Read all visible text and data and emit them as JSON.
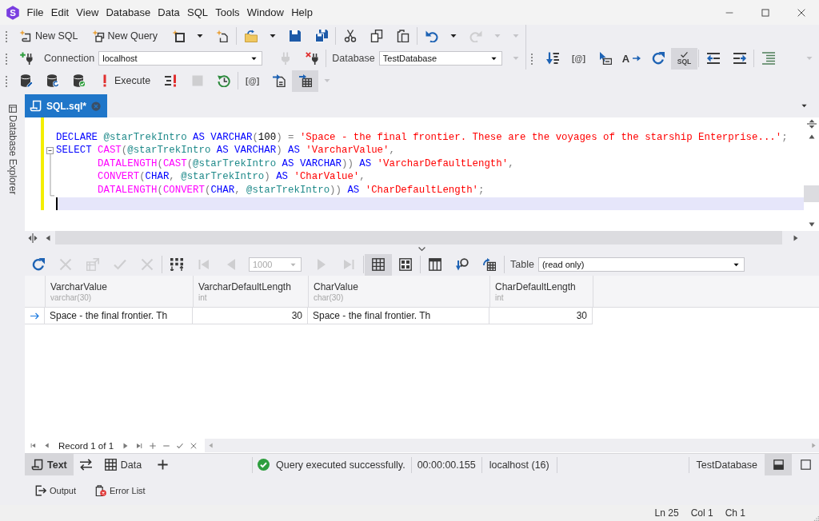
{
  "logo": {
    "letter": "S"
  },
  "menu": [
    "File",
    "Edit",
    "View",
    "Database",
    "Data",
    "SQL",
    "Tools",
    "Window",
    "Help"
  ],
  "toolbars": [
    {
      "groups": [
        [
          {
            "kind": "button",
            "label": "New SQL",
            "disabled": false
          },
          {
            "kind": "button",
            "label": "New Query",
            "disabled": false
          },
          {
            "kind": "button",
            "disabled": false
          },
          {
            "kind": "caret",
            "disabled": false
          },
          {
            "kind": "button",
            "disabled": false
          }
        ],
        [
          {
            "kind": "button",
            "disabled": false
          },
          {
            "kind": "caret",
            "disabled": false
          },
          {
            "kind": "button",
            "disabled": false
          },
          {
            "kind": "button",
            "disabled": false
          }
        ],
        [
          {
            "kind": "button",
            "disabled": false
          },
          {
            "kind": "button",
            "disabled": false
          },
          {
            "kind": "button",
            "disabled": false
          }
        ],
        [
          {
            "kind": "button",
            "disabled": false
          },
          {
            "kind": "caret",
            "disabled": false
          },
          {
            "kind": "button",
            "disabled": true
          },
          {
            "kind": "caret",
            "disabled": true
          },
          {
            "kind": "overflow",
            "disabled": true
          }
        ]
      ]
    },
    {
      "groups": [
        [
          {
            "kind": "button",
            "disabled": false
          },
          {
            "kind": "label",
            "text": "Connection",
            "disabled": false
          },
          {
            "kind": "combo",
            "value": "localhost",
            "disabled": false
          },
          {
            "kind": "button",
            "disabled": true
          },
          {
            "kind": "button",
            "disabled": false
          }
        ],
        [
          {
            "kind": "label",
            "text": "Database",
            "disabled": false
          },
          {
            "kind": "combo",
            "value": "TestDatabase",
            "disabled": false
          },
          {
            "kind": "overflow",
            "disabled": true
          }
        ]
      ]
    },
    {
      "groups": [
        [
          {
            "kind": "button",
            "disabled": false
          },
          {
            "kind": "button",
            "icon_text": "[@]",
            "disabled": false
          },
          {
            "kind": "button",
            "disabled": false
          },
          {
            "kind": "button",
            "icon_text": "A",
            "disabled": false
          },
          {
            "kind": "button",
            "disabled": false
          },
          {
            "kind": "toggle",
            "icon_text": "SQL",
            "disabled": false,
            "on": true
          }
        ],
        [
          {
            "kind": "button",
            "disabled": false
          },
          {
            "kind": "button",
            "disabled": false
          }
        ],
        [
          {
            "kind": "button",
            "disabled": false
          },
          {
            "kind": "overflow",
            "disabled": true
          }
        ]
      ]
    },
    {
      "groups": [
        [
          {
            "kind": "button",
            "disabled": false
          },
          {
            "kind": "button",
            "disabled": false
          },
          {
            "kind": "button",
            "disabled": false
          },
          {
            "kind": "button",
            "label": "Execute",
            "disabled": false
          },
          {
            "kind": "button",
            "disabled": false
          },
          {
            "kind": "button",
            "disabled": true
          },
          {
            "kind": "button",
            "disabled": false
          }
        ],
        [
          {
            "kind": "button",
            "icon_text": "[@]",
            "disabled": false
          },
          {
            "kind": "button",
            "disabled": false
          },
          {
            "kind": "toggle",
            "disabled": false,
            "on": true
          },
          {
            "kind": "caret",
            "disabled": true
          }
        ]
      ]
    }
  ],
  "document_tabs": [
    {
      "title": "SQL.sql*",
      "selected": true
    }
  ],
  "side_panel": {
    "label": "Database Explorer"
  },
  "editor": {
    "lines": [
      {
        "modified": true,
        "tokens": [
          {
            "kind": "keyword",
            "text": "DECLARE "
          },
          {
            "kind": "variable",
            "text": "@starTrekIntro "
          },
          {
            "kind": "keyword",
            "text": "AS VARCHAR"
          },
          {
            "kind": "punct",
            "text": "("
          },
          {
            "kind": "number",
            "text": "100"
          },
          {
            "kind": "punct",
            "text": ") = "
          },
          {
            "kind": "string",
            "text": "'Space - the final frontier. These are the voyages of the starship Enterprise...'"
          },
          {
            "kind": "punct",
            "text": ";"
          }
        ]
      },
      {
        "modified": true,
        "expanded": true,
        "tokens": [
          {
            "kind": "keyword",
            "text": "SELECT "
          },
          {
            "kind": "function",
            "text": "CAST"
          },
          {
            "kind": "punct",
            "text": "("
          },
          {
            "kind": "variable",
            "text": "@starTrekIntro "
          },
          {
            "kind": "keyword",
            "text": "AS VARCHAR"
          },
          {
            "kind": "punct",
            "text": ") "
          },
          {
            "kind": "keyword",
            "text": "AS "
          },
          {
            "kind": "string",
            "text": "'VarcharValue'"
          },
          {
            "kind": "punct",
            "text": ","
          }
        ],
        "children": [
          {
            "modified": true,
            "tokens": [
              {
                "kind": "function",
                "text": "DATALENGTH"
              },
              {
                "kind": "punct",
                "text": "("
              },
              {
                "kind": "function",
                "text": "CAST"
              },
              {
                "kind": "punct",
                "text": "("
              },
              {
                "kind": "variable",
                "text": "@starTrekIntro "
              },
              {
                "kind": "keyword",
                "text": "AS VARCHAR"
              },
              {
                "kind": "punct",
                "text": ")) "
              },
              {
                "kind": "keyword",
                "text": "AS "
              },
              {
                "kind": "string",
                "text": "'VarcharDefaultLength'"
              },
              {
                "kind": "punct",
                "text": ","
              }
            ]
          },
          {
            "modified": true,
            "tokens": [
              {
                "kind": "function",
                "text": "CONVERT"
              },
              {
                "kind": "punct",
                "text": "("
              },
              {
                "kind": "keyword",
                "text": "CHAR"
              },
              {
                "kind": "punct",
                "text": ", "
              },
              {
                "kind": "variable",
                "text": "@starTrekIntro"
              },
              {
                "kind": "punct",
                "text": ") "
              },
              {
                "kind": "keyword",
                "text": "AS "
              },
              {
                "kind": "string",
                "text": "'CharValue'"
              },
              {
                "kind": "punct",
                "text": ","
              }
            ]
          },
          {
            "modified": true,
            "tokens": [
              {
                "kind": "function",
                "text": "DATALENGTH"
              },
              {
                "kind": "punct",
                "text": "("
              },
              {
                "kind": "function",
                "text": "CONVERT"
              },
              {
                "kind": "punct",
                "text": "("
              },
              {
                "kind": "keyword",
                "text": "CHAR"
              },
              {
                "kind": "punct",
                "text": ", "
              },
              {
                "kind": "variable",
                "text": "@starTrekIntro"
              },
              {
                "kind": "punct",
                "text": ")) "
              },
              {
                "kind": "keyword",
                "text": "AS "
              },
              {
                "kind": "string",
                "text": "'CharDefaultLength'"
              },
              {
                "kind": "punct",
                "text": ";"
              }
            ]
          }
        ]
      }
    ]
  },
  "results": {
    "toolbar": {
      "groups": [
        [
          {
            "kind": "button",
            "disabled": false
          },
          {
            "kind": "button",
            "disabled": true
          },
          {
            "kind": "button",
            "disabled": true
          },
          {
            "kind": "button",
            "disabled": true
          },
          {
            "kind": "button",
            "disabled": true
          }
        ],
        [
          {
            "kind": "button",
            "disabled": false
          },
          {
            "kind": "button",
            "disabled": true
          },
          {
            "kind": "button",
            "disabled": true
          },
          {
            "kind": "combo",
            "value": "1000",
            "disabled": true
          },
          {
            "kind": "button",
            "disabled": true
          },
          {
            "kind": "button",
            "disabled": true
          }
        ],
        [
          {
            "kind": "toggle",
            "disabled": false,
            "on": true
          },
          {
            "kind": "toggle",
            "disabled": false,
            "on": false
          }
        ],
        [
          {
            "kind": "button",
            "disabled": false
          },
          {
            "kind": "button",
            "disabled": false
          },
          {
            "kind": "button",
            "disabled": false
          }
        ],
        [
          {
            "kind": "label",
            "text": "Table",
            "disabled": false
          },
          {
            "kind": "combo",
            "value": "(read only)",
            "disabled": false
          }
        ]
      ]
    },
    "grid": {
      "columns": [
        {
          "name": "VarcharValue",
          "type": "varchar(30)",
          "kind": "text"
        },
        {
          "name": "VarcharDefaultLength",
          "type": "int",
          "kind": "number"
        },
        {
          "name": "CharValue",
          "type": "char(30)",
          "kind": "text"
        },
        {
          "name": "CharDefaultLength",
          "type": "int",
          "kind": "number"
        }
      ],
      "rows": [
        {
          "selected": true,
          "cells": [
            "Space - the final frontier. Th",
            "30",
            "Space - the final frontier. Th",
            "30"
          ]
        }
      ]
    },
    "navigator": {
      "record": "Record 1 of 1"
    }
  },
  "bottom_tabs": [
    {
      "label": "Text",
      "selected": true
    },
    {
      "selected": false
    },
    {
      "label": "Data",
      "selected": false
    }
  ],
  "status": {
    "kind": "success",
    "message": "Query executed successfully.",
    "elapsed": "00:00:00.155",
    "server": "localhost (16)",
    "database": "TestDatabase"
  },
  "view_buttons": [
    {
      "selected": true
    },
    {
      "selected": false
    }
  ],
  "panels": [
    {
      "label": "Output"
    },
    {
      "label": "Error List"
    }
  ],
  "status_bar": {
    "line": "Ln 25",
    "column": "Col 1",
    "char": "Ch 1"
  }
}
